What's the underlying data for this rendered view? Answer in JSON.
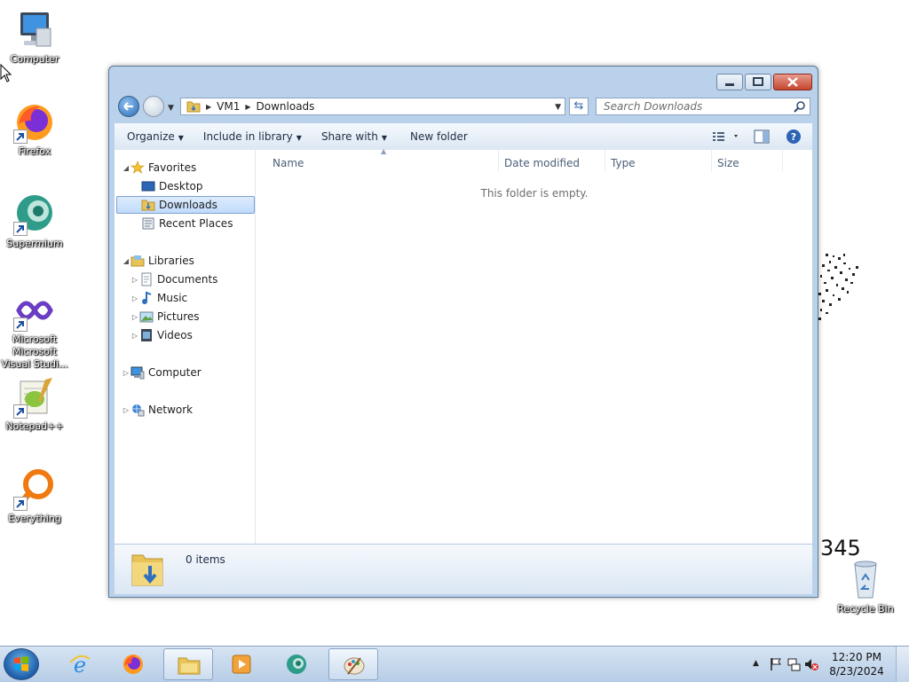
{
  "desktop": {
    "icons": [
      {
        "label": "Computer",
        "icon": "computer-icon"
      },
      {
        "label": "Firefox",
        "icon": "firefox-icon"
      },
      {
        "label": "Supermium",
        "icon": "supermium-icon"
      },
      {
        "label": "Microsoft Visual Studi...",
        "icon": "visual-studio-icon"
      },
      {
        "label": "Notepad++",
        "icon": "notepad-plus-plus-icon"
      },
      {
        "label": "Everything",
        "icon": "everything-icon"
      },
      {
        "label": "Recycle Bin",
        "icon": "recycle-bin-icon"
      }
    ],
    "sticker_number": "345"
  },
  "window": {
    "breadcrumb": [
      "VM1",
      "Downloads"
    ],
    "search_placeholder": "Search Downloads",
    "commands": {
      "organize": "Organize",
      "include_in_library": "Include in library",
      "share_with": "Share with",
      "new_folder": "New folder"
    },
    "nav": {
      "favorites": "Favorites",
      "desktop": "Desktop",
      "downloads": "Downloads",
      "recent_places": "Recent Places",
      "libraries": "Libraries",
      "documents": "Documents",
      "music": "Music",
      "pictures": "Pictures",
      "videos": "Videos",
      "computer": "Computer",
      "network": "Network"
    },
    "columns": [
      "Name",
      "Date modified",
      "Type",
      "Size"
    ],
    "empty_message": "This folder is empty.",
    "item_count": "0 items"
  },
  "taskbar": {
    "time": "12:20 PM",
    "date": "8/23/2024",
    "pinned": [
      "internet-explorer-icon",
      "firefox-icon",
      "file-explorer-icon",
      "media-player-icon",
      "supermium-icon",
      "paint-icon"
    ]
  },
  "colors": {
    "window_frame": "#b9d1ea",
    "selection": "#c1dbfc",
    "taskbar": "#c5d8ee"
  }
}
